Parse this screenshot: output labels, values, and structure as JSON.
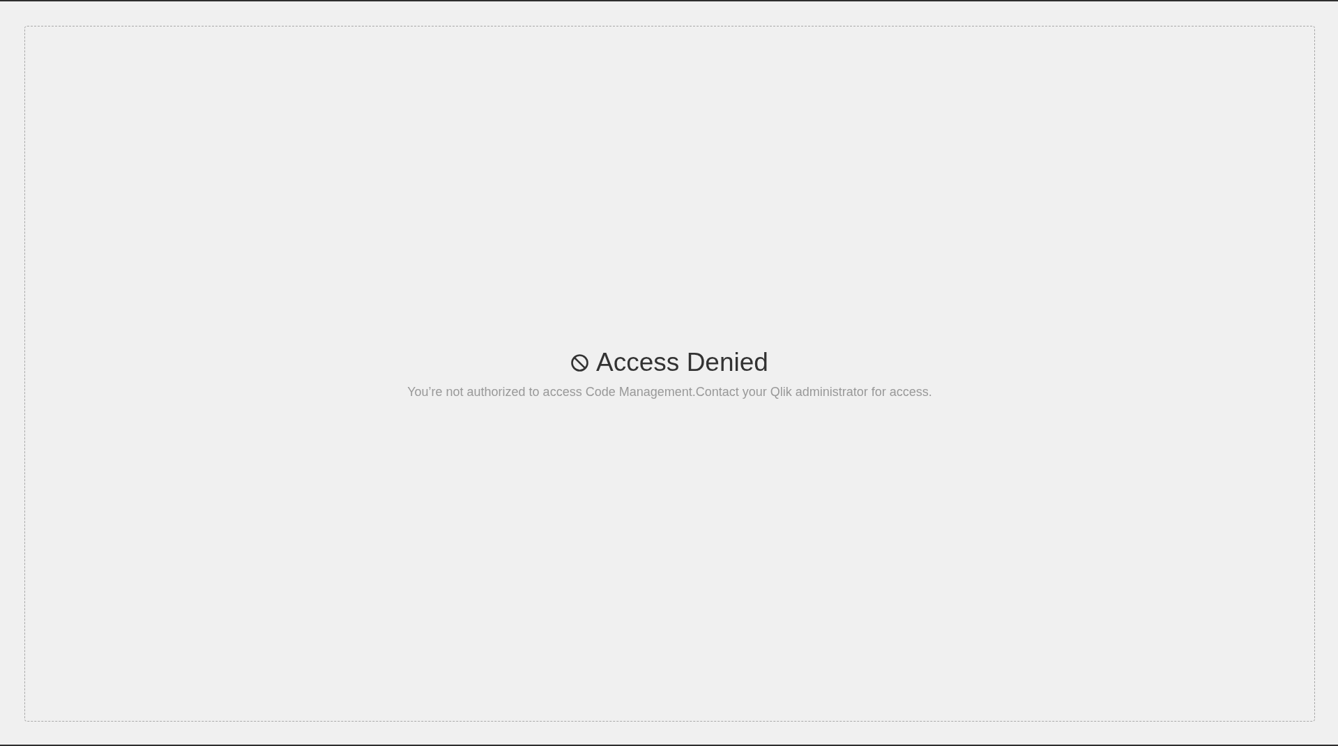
{
  "message": {
    "title": "Access Denied",
    "description": "You’re not authorized to access Code Management.Contact your Qlik administrator for access."
  }
}
